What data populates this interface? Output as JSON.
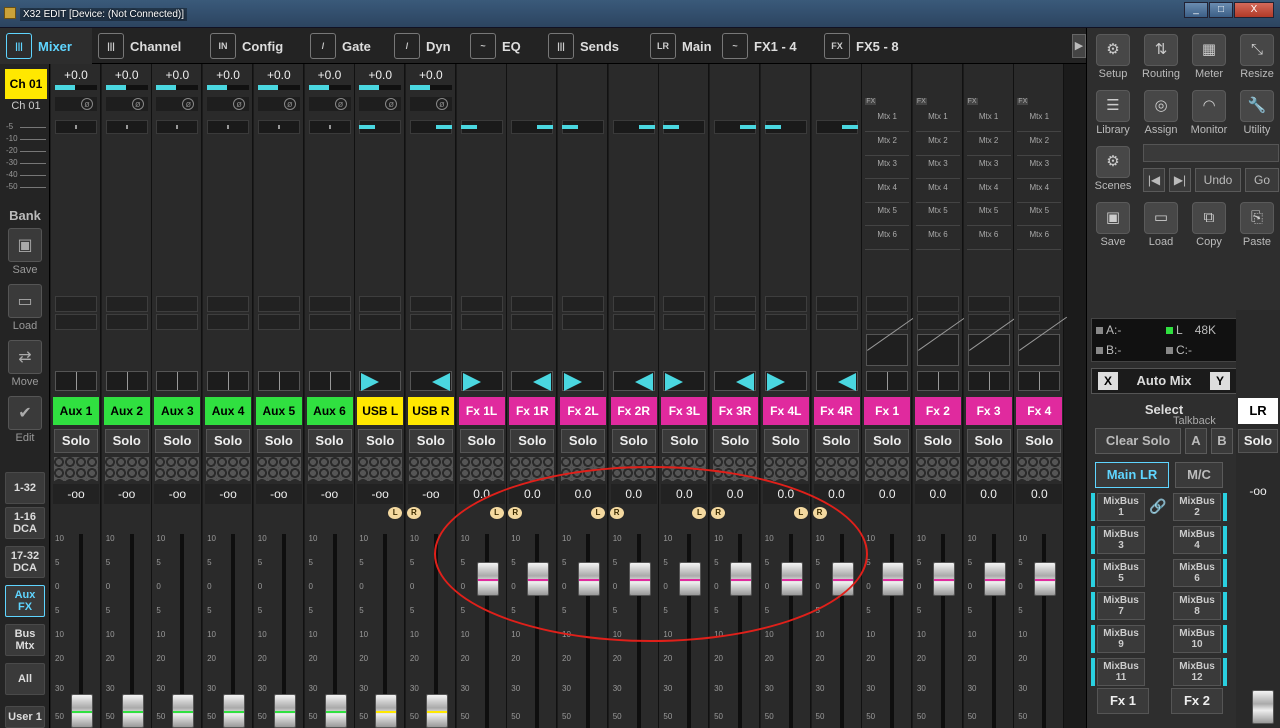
{
  "window": {
    "title": "X32 EDIT [Device: (Not Connected)]",
    "min": "_",
    "max": "□",
    "close": "X"
  },
  "tabs": [
    {
      "label": "Mixer",
      "icon": "|||",
      "active": true
    },
    {
      "label": "Channel",
      "icon": "|||"
    },
    {
      "label": "Config",
      "icon": "IN"
    },
    {
      "label": "Gate",
      "icon": "/"
    },
    {
      "label": "Dyn",
      "icon": "/"
    },
    {
      "label": "EQ",
      "icon": "~"
    },
    {
      "label": "Sends",
      "icon": "|||"
    },
    {
      "label": "Main",
      "icon": "LR"
    },
    {
      "label": "FX1 - 4",
      "icon": "~"
    },
    {
      "label": "FX5 - 8",
      "icon": "FX"
    }
  ],
  "left": {
    "selected_channel": "Ch 01",
    "channel_label": "Ch 01",
    "meter_ticks": [
      "-5",
      "-10",
      "-20",
      "-30",
      "-40",
      "-50"
    ],
    "bank_label": "Bank",
    "actions": [
      "Save",
      "Load",
      "Move",
      "Edit"
    ],
    "banks": [
      "1-32",
      "1-16\nDCA",
      "17-32\nDCA",
      "Aux\nFX",
      "Bus\nMtx",
      "All",
      "User 1"
    ]
  },
  "strips": [
    {
      "name": "Aux 1",
      "color": "#30e040",
      "gain": "+0.0",
      "fader": "-oo",
      "kind": "aux"
    },
    {
      "name": "Aux 2",
      "color": "#30e040",
      "gain": "+0.0",
      "fader": "-oo",
      "kind": "aux"
    },
    {
      "name": "Aux 3",
      "color": "#30e040",
      "gain": "+0.0",
      "fader": "-oo",
      "kind": "aux"
    },
    {
      "name": "Aux 4",
      "color": "#30e040",
      "gain": "+0.0",
      "fader": "-oo",
      "kind": "aux"
    },
    {
      "name": "Aux 5",
      "color": "#30e040",
      "gain": "+0.0",
      "fader": "-oo",
      "kind": "aux"
    },
    {
      "name": "Aux 6",
      "color": "#30e040",
      "gain": "+0.0",
      "fader": "-oo",
      "kind": "aux"
    },
    {
      "name": "USB L",
      "color": "#ffe800",
      "gain": "+0.0",
      "fader": "-oo",
      "kind": "usb",
      "lr": "L"
    },
    {
      "name": "USB R",
      "color": "#ffe800",
      "gain": "+0.0",
      "fader": "-oo",
      "kind": "usb",
      "lr": "R"
    },
    {
      "name": "Fx 1L",
      "color": "#e02a9e",
      "fader": "0.0",
      "kind": "fxret",
      "lr": "L"
    },
    {
      "name": "Fx 1R",
      "color": "#e02a9e",
      "fader": "0.0",
      "kind": "fxret",
      "lr": "R"
    },
    {
      "name": "Fx 2L",
      "color": "#e02a9e",
      "fader": "0.0",
      "kind": "fxret",
      "lr": "L"
    },
    {
      "name": "Fx 2R",
      "color": "#e02a9e",
      "fader": "0.0",
      "kind": "fxret",
      "lr": "R"
    },
    {
      "name": "Fx 3L",
      "color": "#e02a9e",
      "fader": "0.0",
      "kind": "fxret",
      "lr": "L"
    },
    {
      "name": "Fx 3R",
      "color": "#e02a9e",
      "fader": "0.0",
      "kind": "fxret",
      "lr": "R"
    },
    {
      "name": "Fx 4L",
      "color": "#e02a9e",
      "fader": "0.0",
      "kind": "fxret",
      "lr": "L"
    },
    {
      "name": "Fx 4R",
      "color": "#e02a9e",
      "fader": "0.0",
      "kind": "fxret",
      "lr": "R"
    },
    {
      "name": "Fx 1",
      "color": "#e02a9e",
      "fader": "0.0",
      "kind": "fxbus"
    },
    {
      "name": "Fx 2",
      "color": "#e02a9e",
      "fader": "0.0",
      "kind": "fxbus"
    },
    {
      "name": "Fx 3",
      "color": "#e02a9e",
      "fader": "0.0",
      "kind": "fxbus"
    },
    {
      "name": "Fx 4",
      "color": "#e02a9e",
      "fader": "0.0",
      "kind": "fxbus"
    }
  ],
  "solo_label": "Solo",
  "lr_labels": {
    "L": "L",
    "R": "R"
  },
  "fx_tag": "FX",
  "matrix_labels": [
    "Mtx 1",
    "Mtx 2",
    "Mtx 3",
    "Mtx 4",
    "Mtx 5",
    "Mtx 6"
  ],
  "fader_scale": [
    "10",
    "5",
    "0",
    "5",
    "10",
    "20",
    "30",
    "50"
  ],
  "right": {
    "row1": [
      {
        "label": "Setup",
        "icon": "⚙"
      },
      {
        "label": "Routing",
        "icon": "⇅"
      },
      {
        "label": "Meter",
        "icon": "▦"
      },
      {
        "label": "Resize",
        "icon": "⤡"
      }
    ],
    "row2": [
      {
        "label": "Library",
        "icon": "☰"
      },
      {
        "label": "Assign",
        "icon": "◎"
      },
      {
        "label": "Monitor",
        "icon": "◠"
      },
      {
        "label": "Utility",
        "icon": "🔧"
      }
    ],
    "scenes": {
      "label": "Scenes",
      "icon": "⚙"
    },
    "nav": {
      "prev": "|◀",
      "next": "▶|",
      "undo": "Undo",
      "go": "Go"
    },
    "row4": [
      {
        "label": "Save",
        "icon": "▣"
      },
      {
        "label": "Load",
        "icon": "▭"
      },
      {
        "label": "Copy",
        "icon": "⧉"
      },
      {
        "label": "Paste",
        "icon": "⎘"
      }
    ],
    "status": {
      "a": "A:-",
      "b": "B:-",
      "l": "L",
      "rate": "48K",
      "c": "C:-"
    },
    "automix": {
      "x": "X",
      "label": "Auto Mix",
      "y": "Y"
    },
    "select_title": "Select",
    "talkback": "Talkback",
    "clear_solo": "Clear Solo",
    "tb_a": "A",
    "tb_b": "B",
    "main_lr": "Main LR",
    "mc": "M/C",
    "mixbuses": [
      "MixBus\n1",
      "MixBus\n2",
      "MixBus\n3",
      "MixBus\n4",
      "MixBus\n5",
      "MixBus\n6",
      "MixBus\n7",
      "MixBus\n8",
      "MixBus\n9",
      "MixBus\n10",
      "MixBus\n11",
      "MixBus\n12"
    ],
    "fx_buttons": [
      "Fx 1",
      "Fx 2"
    ]
  },
  "master": {
    "name": "LR",
    "solo": "Solo",
    "fader": "-oo"
  }
}
